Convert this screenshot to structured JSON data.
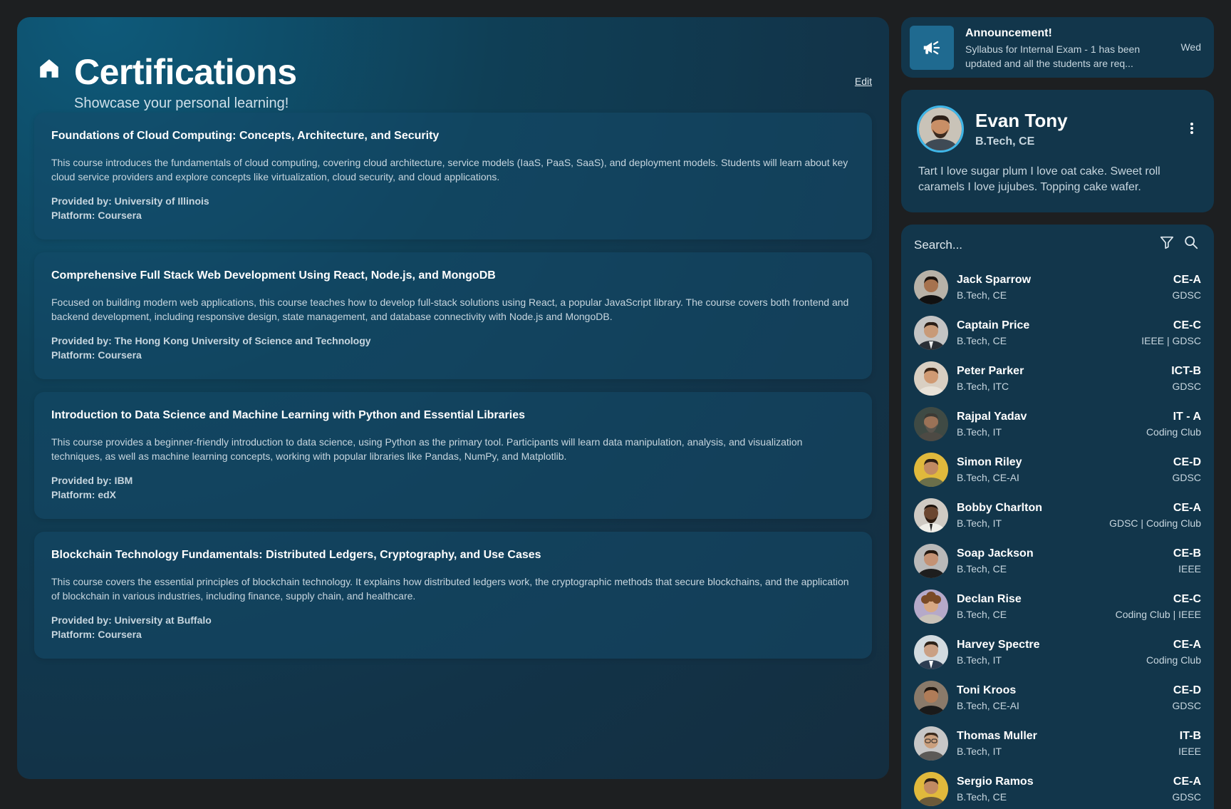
{
  "header": {
    "title": "Certifications",
    "subtitle": "Showcase your personal learning!",
    "edit_label": "Edit"
  },
  "courses": [
    {
      "title": "Foundations of Cloud Computing: Concepts, Architecture, and Security",
      "description": "This course introduces the fundamentals of cloud computing, covering cloud architecture, service models (IaaS, PaaS, SaaS), and deployment models. Students will learn about key cloud service providers and explore concepts like virtualization, cloud security, and cloud applications.",
      "provider": "Provided by: University of Illinois",
      "platform": "Platform: Coursera"
    },
    {
      "title": "Comprehensive Full Stack Web Development Using React, Node.js, and MongoDB",
      "description": "Focused on building modern web applications, this course teaches how to develop full-stack solutions using React, a popular JavaScript library. The course covers both frontend and backend development, including responsive design, state management, and database connectivity with Node.js and MongoDB.",
      "provider": "Provided by: The Hong Kong University of Science and Technology",
      "platform": "Platform: Coursera"
    },
    {
      "title": "Introduction to Data Science and Machine Learning with Python and Essential Libraries",
      "description": "This course provides a beginner-friendly introduction to data science, using Python as the primary tool. Participants will learn data manipulation, analysis, and visualization techniques, as well as machine learning concepts, working with popular libraries like Pandas, NumPy, and Matplotlib.",
      "provider": "Provided by: IBM",
      "platform": "Platform: edX"
    },
    {
      "title": "Blockchain Technology Fundamentals: Distributed Ledgers, Cryptography, and Use Cases",
      "description": "This course covers the essential principles of blockchain technology. It explains how distributed ledgers work, the cryptographic methods that secure blockchains, and the application of blockchain in various industries, including finance, supply chain, and healthcare.",
      "provider": "Provided by: University at Buffalo",
      "platform": "Platform: Coursera"
    }
  ],
  "announcement": {
    "title": "Announcement!",
    "text": "Syllabus for Internal Exam - 1 has been updated and all the students are req...",
    "day": "Wed",
    "icon": "megaphone-icon"
  },
  "profile": {
    "name": "Evan Tony",
    "program": "B.Tech, CE",
    "bio": "Tart I love sugar plum I love oat cake. Sweet roll caramels I love jujubes. Topping cake wafer."
  },
  "search": {
    "placeholder": "Search..."
  },
  "people": [
    {
      "name": "Jack Sparrow",
      "program": "B.Tech, CE",
      "class": "CE-A",
      "clubs": "GDSC"
    },
    {
      "name": "Captain Price",
      "program": "B.Tech, CE",
      "class": "CE-C",
      "clubs": "IEEE | GDSC"
    },
    {
      "name": "Peter Parker",
      "program": "B.Tech, ITC",
      "class": "ICT-B",
      "clubs": "GDSC"
    },
    {
      "name": "Rajpal Yadav",
      "program": "B.Tech, IT",
      "class": "IT - A",
      "clubs": "Coding Club"
    },
    {
      "name": "Simon Riley",
      "program": "B.Tech, CE-AI",
      "class": "CE-D",
      "clubs": "GDSC"
    },
    {
      "name": "Bobby Charlton",
      "program": "B.Tech, IT",
      "class": "CE-A",
      "clubs": "GDSC | Coding Club"
    },
    {
      "name": "Soap Jackson",
      "program": "B.Tech, CE",
      "class": "CE-B",
      "clubs": "IEEE"
    },
    {
      "name": "Declan Rise",
      "program": "B.Tech, CE",
      "class": "CE-C",
      "clubs": "Coding Club | IEEE"
    },
    {
      "name": "Harvey Spectre",
      "program": "B.Tech, IT",
      "class": "CE-A",
      "clubs": "Coding Club"
    },
    {
      "name": "Toni Kroos",
      "program": "B.Tech, CE-AI",
      "class": "CE-D",
      "clubs": "GDSC"
    },
    {
      "name": "Thomas Muller",
      "program": "B.Tech, IT",
      "class": "IT-B",
      "clubs": "IEEE"
    },
    {
      "name": "Sergio Ramos",
      "program": "B.Tech, CE",
      "class": "CE-A",
      "clubs": "GDSC"
    }
  ],
  "colors": {
    "accent": "#3fb6e8",
    "panel": "#12364b",
    "text_muted": "#c7d6df"
  }
}
